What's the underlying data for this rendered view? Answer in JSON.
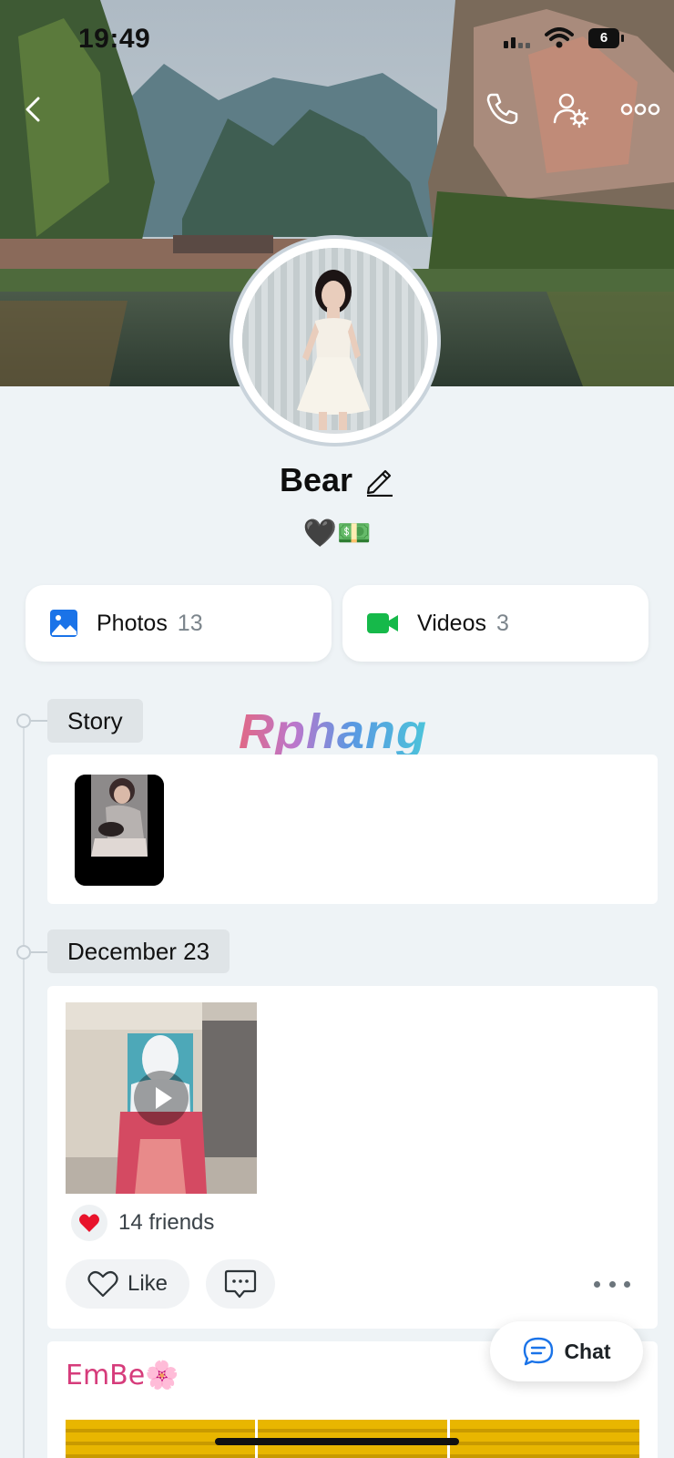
{
  "status_bar": {
    "time": "19:49",
    "battery": "6"
  },
  "profile": {
    "name": "Bear",
    "bio": "🖤💵"
  },
  "media": {
    "photos": {
      "label": "Photos",
      "count": "13"
    },
    "videos": {
      "label": "Videos",
      "count": "3"
    }
  },
  "watermark": "Rphang",
  "timeline": {
    "story_label": "Story",
    "date_label": "December 23"
  },
  "post": {
    "reaction_count": "14 friends",
    "like_label": "Like"
  },
  "post2": {
    "caption": "EmBe🌸"
  },
  "chat_button": {
    "label": "Chat"
  },
  "colors": {
    "accent_blue": "#1a73e8",
    "video_green": "#16b94a",
    "heart_red": "#e8132b",
    "background": "#eef3f6"
  }
}
